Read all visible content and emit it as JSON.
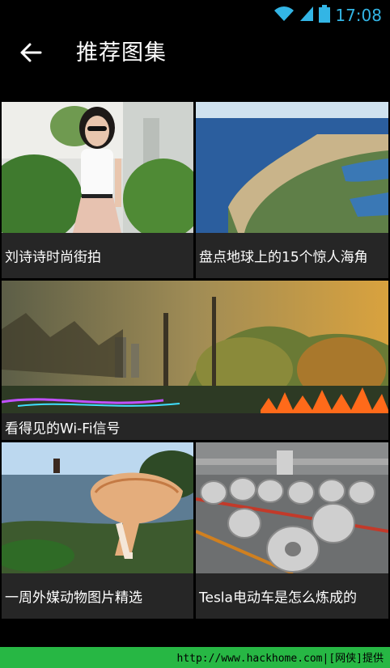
{
  "status_bar": {
    "time": "17:08",
    "wifi_icon": "wifi-icon",
    "signal_icon": "cell-signal-icon",
    "battery_icon": "battery-icon"
  },
  "app_bar": {
    "back_icon": "back-arrow-icon",
    "title": "推荐图集"
  },
  "tiles": [
    {
      "caption": "刘诗诗时尚街拍"
    },
    {
      "caption": "盘点地球上的15个惊人海角"
    },
    {
      "caption": "看得见的Wi-Fi信号"
    },
    {
      "caption": "一周外媒动物图片精选"
    },
    {
      "caption": "Tesla电动车是怎么炼成的"
    }
  ],
  "watermark": {
    "text": "http://www.hackhome.com|[网侠]提供"
  },
  "colors": {
    "accent": "#33b5e5",
    "watermark_bg": "#27b744",
    "caption_bg": "#262626"
  }
}
